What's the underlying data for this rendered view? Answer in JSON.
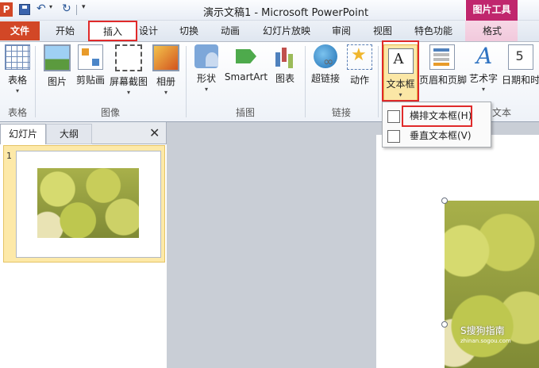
{
  "app": {
    "logo_letter": "P",
    "window_title": "演示文稿1 - Microsoft PowerPoint",
    "context_tool": "图片工具"
  },
  "qat": {
    "undo": "↶",
    "redo": "↻",
    "more": "▾"
  },
  "tabs": [
    {
      "label": "文件"
    },
    {
      "label": "开始"
    },
    {
      "label": "插入"
    },
    {
      "label": "设计"
    },
    {
      "label": "切换"
    },
    {
      "label": "动画"
    },
    {
      "label": "幻灯片放映"
    },
    {
      "label": "审阅"
    },
    {
      "label": "视图"
    },
    {
      "label": "特色功能"
    },
    {
      "label": "格式"
    }
  ],
  "ribbon": {
    "groups": {
      "tables": "表格",
      "images": "图像",
      "illustrations": "插图",
      "links": "链接",
      "text": "文本"
    },
    "buttons": {
      "table": "表格",
      "picture": "图片",
      "clipart": "剪贴画",
      "screenshot": "屏幕截图",
      "album": "相册",
      "shapes": "形状",
      "smartart": "SmartArt",
      "chart": "图表",
      "hyperlink": "超链接",
      "action": "动作",
      "textbox": "文本框",
      "header_footer": "页眉和页脚",
      "wordart": "艺术字",
      "datetime": "日期和时"
    },
    "dropdown_glyph": "▾"
  },
  "textbox_menu": {
    "items": [
      {
        "label": "横排文本框(H)"
      },
      {
        "label": "垂直文本框(V)"
      }
    ]
  },
  "left_pane": {
    "tab_slides": "幻灯片",
    "tab_outline": "大纲",
    "close": "✕",
    "slide_number": "1"
  },
  "watermark": {
    "main": "S搜狗指南",
    "sub": "zhinan.sogou.com"
  },
  "colors": {
    "file_tab": "#d24726",
    "picture_tools": "#c0266d",
    "highlight": "#e02a2a"
  }
}
